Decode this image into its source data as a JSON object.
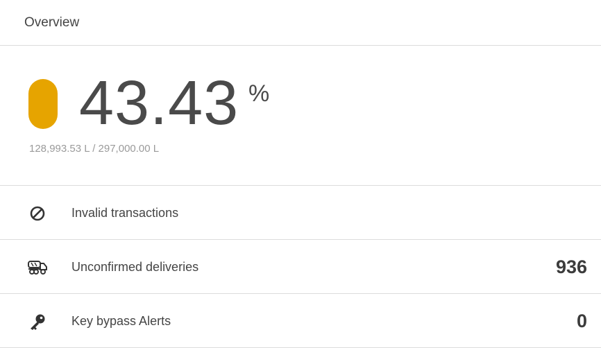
{
  "header": {
    "title": "Overview"
  },
  "gauge": {
    "value": "43.43",
    "unit": "%",
    "fill_percent": 43.43,
    "color": "#e6a400",
    "detail": "128,993.53 L / 297,000.00 L"
  },
  "rows": [
    {
      "label": "Invalid transactions",
      "count": "",
      "icon": "no-entry-icon"
    },
    {
      "label": "Unconfirmed deliveries",
      "count": "936",
      "icon": "tanker-truck-icon"
    },
    {
      "label": "Key bypass Alerts",
      "count": "0",
      "icon": "key-icon"
    }
  ]
}
